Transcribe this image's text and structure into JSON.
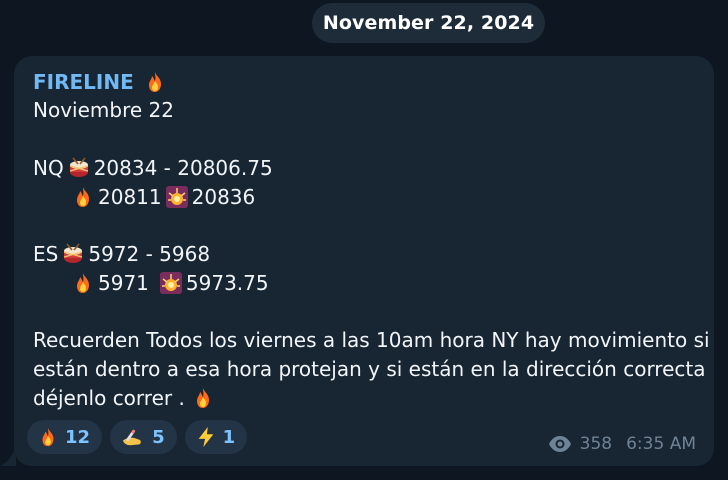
{
  "date_separator": "November 22, 2024",
  "message": {
    "sender": "FIRELINE",
    "lines": {
      "date": "Noviembre 22",
      "nq_label": "NQ",
      "nq_range": "20834 - 20806.75",
      "nq_fire": "20811",
      "nq_burst": "20836",
      "es_label": "ES",
      "es_range": "5972 - 5968",
      "es_fire": "5971",
      "es_burst": "5973.75",
      "body_line_1": "Recuerden Todos los viernes a las 10am hora NY hay movimiento si",
      "body_line_2": "están dentro a esa hora protejan y si están en la dirección correcta",
      "body_line_3": "déjenlo correr ."
    },
    "reactions": [
      {
        "icon": "fire-icon",
        "count": "12"
      },
      {
        "icon": "writing-hand-icon",
        "count": "5"
      },
      {
        "icon": "lightning-icon",
        "count": "1"
      }
    ],
    "views": "358",
    "time": "6:35 AM"
  },
  "colors": {
    "background": "#0e1621",
    "bubble": "#182533",
    "sender": "#71b9f4",
    "reaction_count": "#7cc3ff",
    "meta": "#6f8396"
  }
}
